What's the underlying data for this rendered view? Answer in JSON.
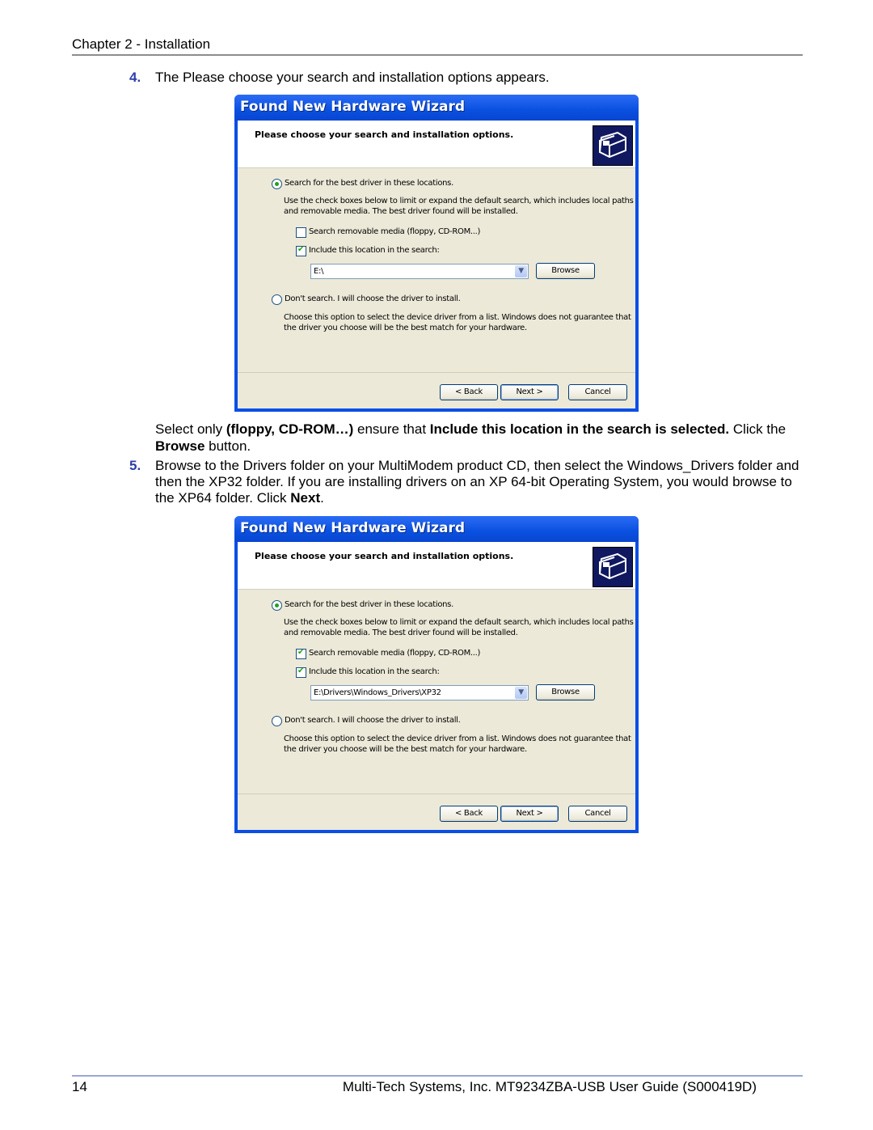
{
  "header": {
    "chapter": "Chapter 2 - Installation"
  },
  "steps": [
    {
      "num": "4.",
      "text": "The Please choose your search and installation options appears."
    },
    {
      "num": "5.",
      "text": "Browse to the Drivers folder on your MultiModem product CD, then select the Windows_Drivers folder and then the XP32 folder. If you are installing drivers on an XP 64-bit Operating System, you would browse to the XP64 folder. Click ",
      "bold_end": "Next",
      "tail": "."
    }
  ],
  "instruction": {
    "p1": "Select only ",
    "b1": "(floppy, CD-ROM…)",
    "p2": " ensure that ",
    "b2": "Include this location in the search is selected.",
    "p3": "  Click the ",
    "b3": "Browse",
    "p4": " button."
  },
  "wizards": [
    {
      "title": "Found New Hardware Wizard",
      "subtitle": "Please choose your search and installation options.",
      "icon": "hardware-icon",
      "option_search": {
        "label": "Search for the best driver in these locations.",
        "selected": true
      },
      "search_desc": "Use the check boxes below to limit or expand the default search, which includes local paths and removable media. The best driver found will be installed.",
      "check_removable": {
        "label": "Search removable media (floppy, CD-ROM...)",
        "checked": false
      },
      "check_include": {
        "label": "Include this location in the search:",
        "checked": true
      },
      "location_value": "E:\\",
      "browse_label": "Browse",
      "option_dont": {
        "label": "Don't search. I will choose the driver to install.",
        "selected": false
      },
      "dont_desc": "Choose this option to select the device driver from a list.  Windows does not guarantee that the driver you choose will be the best match for your hardware.",
      "back_label": "< Back",
      "next_label": "Next >",
      "cancel_label": "Cancel"
    },
    {
      "title": "Found New Hardware Wizard",
      "subtitle": "Please choose your search and installation options.",
      "icon": "hardware-icon",
      "option_search": {
        "label": "Search for the best driver in these locations.",
        "selected": true
      },
      "search_desc": "Use the check boxes below to limit or expand the default search, which includes local paths and removable media. The best driver found will be installed.",
      "check_removable": {
        "label": "Search removable media (floppy, CD-ROM...)",
        "checked": true
      },
      "check_include": {
        "label": "Include this location in the search:",
        "checked": true
      },
      "location_value": "E:\\Drivers\\Windows_Drivers\\XP32",
      "browse_label": "Browse",
      "option_dont": {
        "label": "Don't search. I will choose the driver to install.",
        "selected": false
      },
      "dont_desc": "Choose this option to select the device driver from a list.  Windows does not guarantee that the driver you choose will be the best match for your hardware.",
      "back_label": "< Back",
      "next_label": "Next >",
      "cancel_label": "Cancel"
    }
  ],
  "footer": {
    "page_number": "14",
    "doc_title": "Multi-Tech Systems, Inc. MT9234ZBA-USB User Guide (S000419D)"
  }
}
